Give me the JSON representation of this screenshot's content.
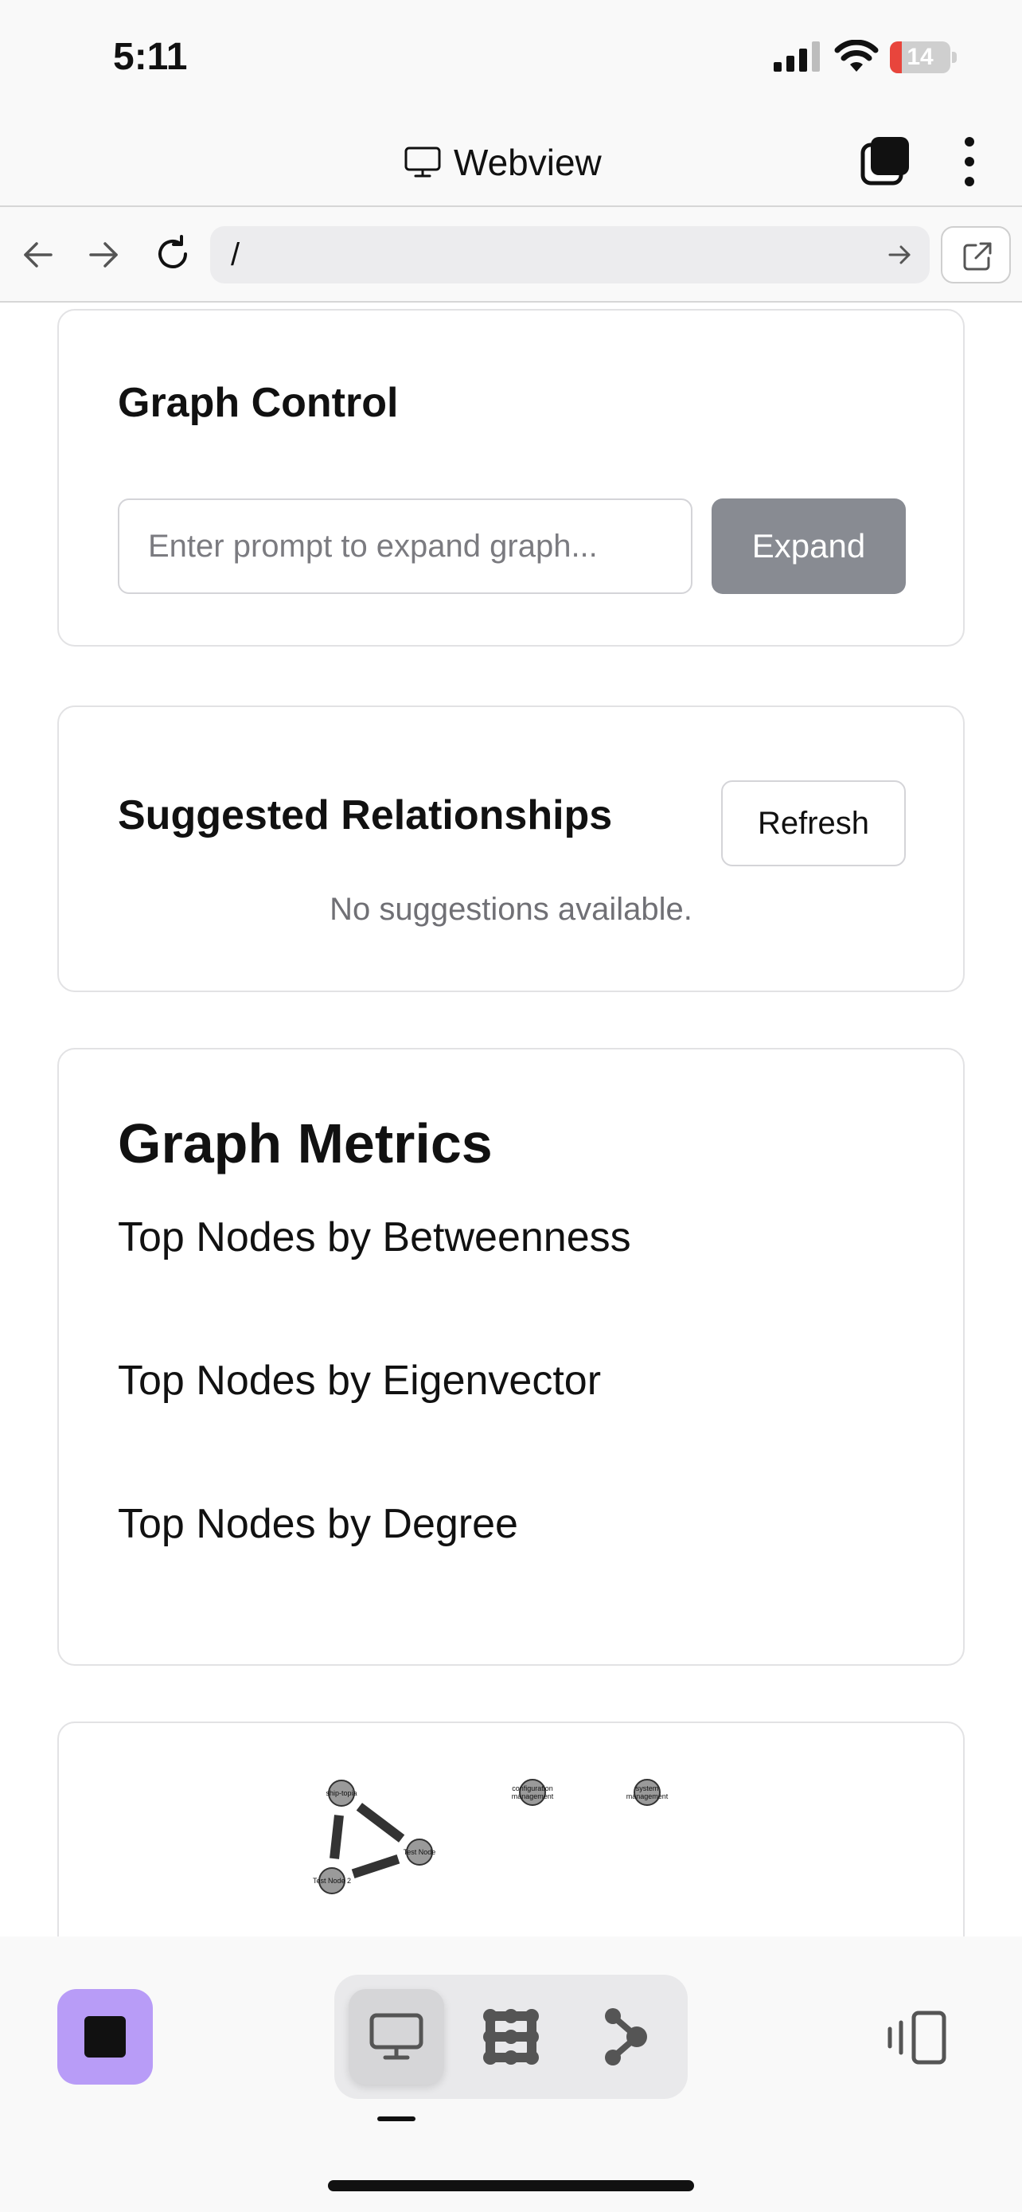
{
  "status_bar": {
    "time": "5:11",
    "battery_level": "14",
    "battery_fraction": 0.14,
    "battery_color": "#e8453c"
  },
  "webview": {
    "title": "Webview",
    "title_icon": "monitor-icon",
    "tabs_icon": "tabs-icon",
    "more_icon": "more-vertical-icon"
  },
  "url_bar": {
    "url": "/",
    "back_icon": "arrow-left-icon",
    "forward_icon": "arrow-right-icon",
    "reload_icon": "reload-icon",
    "go_icon": "arrow-right-icon",
    "open_icon": "external-link-icon"
  },
  "graph_control": {
    "title": "Graph Control",
    "prompt_placeholder": "Enter prompt to expand graph...",
    "prompt_value": "",
    "expand_label": "Expand",
    "expand_color": "#888b92"
  },
  "suggested_relationships": {
    "title": "Suggested Relationships",
    "refresh_label": "Refresh",
    "empty_message": "No suggestions available."
  },
  "graph_metrics": {
    "title": "Graph Metrics",
    "betweenness_heading": "Top Nodes by Betweenness",
    "eigenvector_heading": "Top Nodes by Eigenvector",
    "degree_heading": "Top Nodes by Degree"
  },
  "graph": {
    "nodes": [
      {
        "id": "ship-topia",
        "label": "ship-topia"
      },
      {
        "id": "test-node",
        "label": "Test Node"
      },
      {
        "id": "test-node-2",
        "label": "Test Node 2"
      },
      {
        "id": "configuration-management",
        "label": "configuration management"
      },
      {
        "id": "system-management",
        "label": "system management"
      }
    ],
    "edges": [
      {
        "from": "ship-topia",
        "to": "test-node"
      },
      {
        "from": "ship-topia",
        "to": "test-node-2"
      },
      {
        "from": "test-node-2",
        "to": "test-node"
      }
    ],
    "node_color": "#9a9a9a",
    "edge_color": "#333333"
  },
  "bottom_bar": {
    "stop_icon": "stop-icon",
    "stop_color": "#b89cf7",
    "modes": [
      {
        "name": "desktop",
        "icon": "monitor-icon",
        "selected": true
      },
      {
        "name": "grid",
        "icon": "grid-icon",
        "selected": false
      },
      {
        "name": "graph",
        "icon": "graph-icon",
        "selected": false
      }
    ],
    "device_icon": "device-switch-icon"
  }
}
